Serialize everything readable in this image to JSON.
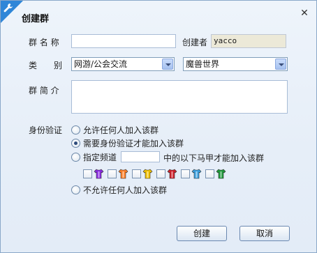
{
  "dialog": {
    "title": "创建群",
    "title_icon": "wrench-icon",
    "close_icon": "close-icon"
  },
  "form": {
    "name_label": "群 名 称",
    "name_value": "",
    "creator_label": "创建者",
    "creator_value": "yacco",
    "category_label": "类　　别",
    "category_value": "网游/公会交流",
    "subcategory_value": "魔兽世界",
    "intro_label": "群 简 介",
    "intro_value": ""
  },
  "verification": {
    "label": "身份验证",
    "options": [
      {
        "label": "允许任何人加入该群",
        "checked": false
      },
      {
        "label": "需要身份验证才能加入该群",
        "checked": true
      },
      {
        "label": "指定频道",
        "checked": false
      },
      {
        "label": "不允许任何人加入该群",
        "checked": false
      }
    ],
    "channel_suffix": "中的以下马甲才能加入该群",
    "ranks": [
      {
        "color": "#8a2be2",
        "icon": "purple-vest-icon",
        "checked": false
      },
      {
        "color": "#ff7f27",
        "icon": "orange-vest-icon",
        "checked": false
      },
      {
        "color": "#f2c200",
        "icon": "yellow-vest-icon",
        "checked": false
      },
      {
        "color": "#d0202a",
        "icon": "red-vest-icon",
        "checked": false
      },
      {
        "color": "#3aa0e0",
        "icon": "blue-vest-icon",
        "checked": false
      },
      {
        "color": "#1e9a3a",
        "icon": "green-vest-icon",
        "checked": false
      }
    ]
  },
  "buttons": {
    "create": "创建",
    "cancel": "取消"
  }
}
